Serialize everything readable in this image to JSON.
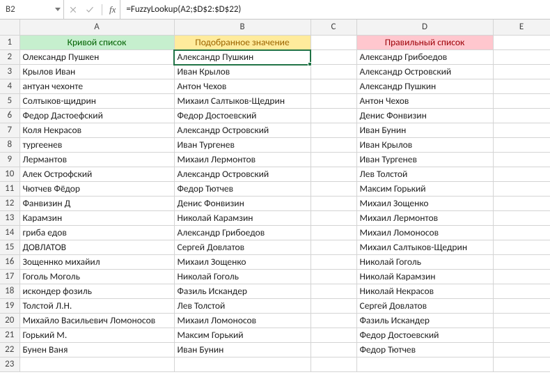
{
  "formula_bar": {
    "name_box": "B2",
    "fx_label": "fx",
    "formula": "=FuzzyLookup(A2;$D$2:$D$22)"
  },
  "columns": {
    "labels": [
      "A",
      "B",
      "C",
      "D",
      "E"
    ]
  },
  "headers": {
    "A": "Кривой список",
    "B": "Подобранное значение",
    "D": "Правильный список"
  },
  "chart_data": {
    "type": "table",
    "rows": [
      {
        "n": 1,
        "A": "Кривой список",
        "B": "Подобранное значение",
        "C": "",
        "D": "Правильный список",
        "E": ""
      },
      {
        "n": 2,
        "A": "Олександр Пушкен",
        "B": "Александр Пушкин",
        "C": "",
        "D": "Александр Грибоедов",
        "E": ""
      },
      {
        "n": 3,
        "A": "Крылов Иван",
        "B": "Иван Крылов",
        "C": "",
        "D": "Александр Островский",
        "E": ""
      },
      {
        "n": 4,
        "A": "антуан чехонте",
        "B": "Антон Чехов",
        "C": "",
        "D": "Александр Пушкин",
        "E": ""
      },
      {
        "n": 5,
        "A": "Солтыков-щидрин",
        "B": "Михаил Салтыков-Щедрин",
        "C": "",
        "D": "Антон Чехов",
        "E": ""
      },
      {
        "n": 6,
        "A": "Федор Дастоефский",
        "B": "Федор Достоевский",
        "C": "",
        "D": "Денис Фонвизин",
        "E": ""
      },
      {
        "n": 7,
        "A": "Коля Некрасов",
        "B": "Александр Островский",
        "C": "",
        "D": "Иван Бунин",
        "E": ""
      },
      {
        "n": 8,
        "A": "тургеенев",
        "B": "Иван Тургенев",
        "C": "",
        "D": "Иван Крылов",
        "E": ""
      },
      {
        "n": 9,
        "A": "Лермантов",
        "B": "Михаил Лермонтов",
        "C": "",
        "D": "Иван Тургенев",
        "E": ""
      },
      {
        "n": 10,
        "A": "Алек Острофский",
        "B": "Александр Островский",
        "C": "",
        "D": "Лев Толстой",
        "E": ""
      },
      {
        "n": 11,
        "A": "Чютчев Фёдор",
        "B": "Федор Тютчев",
        "C": "",
        "D": "Максим Горький",
        "E": ""
      },
      {
        "n": 12,
        "A": "Фанвизин Д",
        "B": "Денис Фонвизин",
        "C": "",
        "D": "Михаил Зощенко",
        "E": ""
      },
      {
        "n": 13,
        "A": "Карамзин",
        "B": "Николай Карамзин",
        "C": "",
        "D": "Михаил Лермонтов",
        "E": ""
      },
      {
        "n": 14,
        "A": "гриба едов",
        "B": "Александр Грибоедов",
        "C": "",
        "D": "Михаил Ломоносов",
        "E": ""
      },
      {
        "n": 15,
        "A": "ДОВЛАТОВ",
        "B": "Сергей Довлатов",
        "C": "",
        "D": "Михаил Салтыков-Щедрин",
        "E": ""
      },
      {
        "n": 16,
        "A": "Зощеннко михайил",
        "B": "Михаил Зощенко",
        "C": "",
        "D": "Николай Гоголь",
        "E": ""
      },
      {
        "n": 17,
        "A": "Гоголь Моголь",
        "B": "Николай Гоголь",
        "C": "",
        "D": "Николай Карамзин",
        "E": ""
      },
      {
        "n": 18,
        "A": "искондер фозиль",
        "B": "Фазиль Искандер",
        "C": "",
        "D": "Николай Некрасов",
        "E": ""
      },
      {
        "n": 19,
        "A": "Толстой Л.Н.",
        "B": "Лев Толстой",
        "C": "",
        "D": "Сергей Довлатов",
        "E": ""
      },
      {
        "n": 20,
        "A": "Михайло Васильевич Ломоносов",
        "B": "Михаил Ломоносов",
        "C": "",
        "D": "Фазиль Искандер",
        "E": ""
      },
      {
        "n": 21,
        "A": "Горький М.",
        "B": "Максим Горький",
        "C": "",
        "D": "Федор Достоевский",
        "E": ""
      },
      {
        "n": 22,
        "A": "Бунен Ваня",
        "B": "Иван Бунин",
        "C": "",
        "D": "Федор Тютчев",
        "E": ""
      },
      {
        "n": 23,
        "A": "",
        "B": "",
        "C": "",
        "D": "",
        "E": ""
      }
    ]
  },
  "selection": {
    "cell": "B2"
  }
}
